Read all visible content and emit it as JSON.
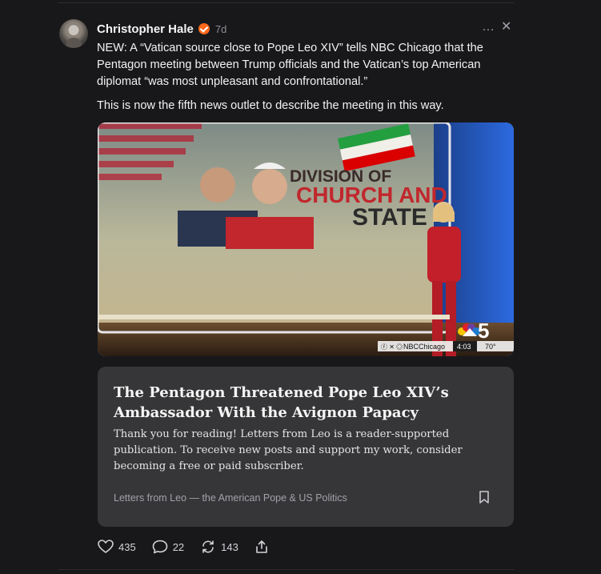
{
  "post": {
    "author": "Christopher Hale",
    "age": "7d",
    "more_icon": "…",
    "close_icon": "✕",
    "paragraphs": [
      "NEW: A “Vatican source close to Pope Leo XIV” tells NBC Chicago that the Pentagon meeting between Trump officials and the Vatican’s top American diplomat “was most unpleasant and confrontational.”",
      "This is now the fifth news outlet to describe the meeting in this way."
    ]
  },
  "media": {
    "headline_line1": "DIVISION OF",
    "headline_line2": "CHURCH AND",
    "headline_line3": "STATE",
    "channel_number": "5",
    "social_handle": "NBCChicago",
    "time": "4:03",
    "temperature": "70°"
  },
  "card": {
    "title": "The Pentagon Threatened Pope Leo XIV’s Ambassador With the Avignon Papacy",
    "description": "Thank you for reading! Letters from Leo is a reader-supported publication. To receive new posts and support my work, consider becoming a free or paid subscriber.",
    "source": "Letters from Leo — the American Pope & US Politics"
  },
  "actions": {
    "likes": "435",
    "comments": "22",
    "restacks": "143"
  },
  "colors": {
    "background": "#18181b",
    "card": "#363638",
    "verified": "#ff6719",
    "nbc_red": "#b3202d"
  }
}
